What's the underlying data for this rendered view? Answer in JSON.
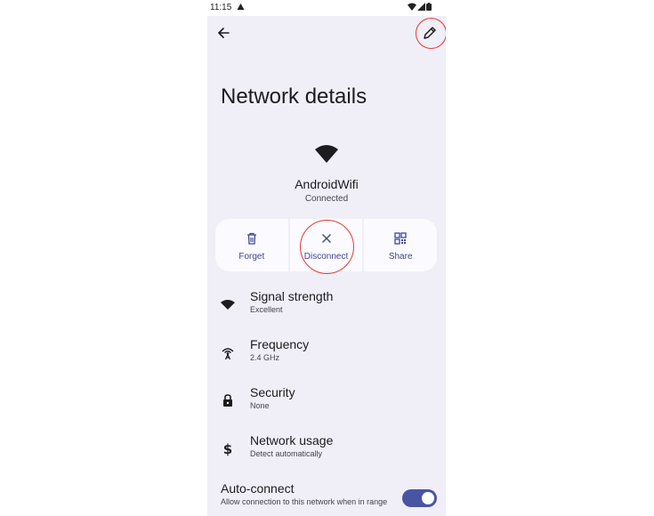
{
  "status_bar": {
    "time": "11:15",
    "alert_icon": "warning-icon"
  },
  "title": "Network details",
  "network": {
    "name": "AndroidWifi",
    "status": "Connected"
  },
  "actions": [
    {
      "label": "Forget",
      "icon": "trash-icon"
    },
    {
      "label": "Disconnect",
      "icon": "close-icon"
    },
    {
      "label": "Share",
      "icon": "qr-code-icon"
    }
  ],
  "details": [
    {
      "title": "Signal strength",
      "value": "Excellent",
      "icon": "wifi-icon"
    },
    {
      "title": "Frequency",
      "value": "2.4 GHz",
      "icon": "antenna-icon"
    },
    {
      "title": "Security",
      "value": "None",
      "icon": "lock-icon"
    },
    {
      "title": "Network usage",
      "value": "Detect automatically",
      "icon": "dollar-icon"
    }
  ],
  "auto_connect": {
    "title": "Auto-connect",
    "subtitle": "Allow connection to this network when in range",
    "enabled": true
  },
  "colors": {
    "accent": "#4a55a2",
    "background": "#f0eef7",
    "highlight_ring": "#e53a2e"
  }
}
